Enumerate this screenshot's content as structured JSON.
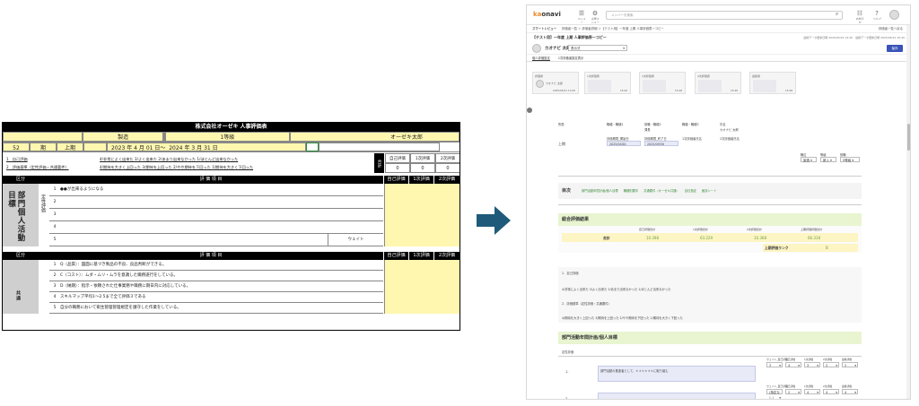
{
  "sheet": {
    "title": "株式会社オーゼキ 人事評価表",
    "row1": {
      "dept": "製造",
      "grade": "1等級",
      "name": "オーゼキ太郎"
    },
    "row2": {
      "period_no": "52",
      "period_unit": "期",
      "half": "上期",
      "from_year": "2023",
      "y1": "年",
      "from_month": "4",
      "m1": "月",
      "from_day": "01",
      "d1": "日～",
      "to_year": "2024",
      "y2": "年",
      "to_month": "3",
      "m2": "月",
      "to_day": "31",
      "d2": "日"
    },
    "legend": {
      "item1": "1　自己評価",
      "scale1": "4/非常によく出来た 3/よく出来た 2/あまり出来なかった 1/ほとんど出来なかった",
      "item2": "2　評価基準（定性評価・共通要件）",
      "scale2": "4/期待を大きく上回った 3/期待を上回った 2/やや期待を下回った 1/期待を大きく下回った",
      "total_label": "合計"
    },
    "score_headers": [
      "自己評価",
      "1次評価",
      "2次評価"
    ],
    "totals": [
      "0",
      "0",
      "0"
    ],
    "section1": {
      "col_kubun": "区分",
      "col_items": "評 価 項 目",
      "side_label": "部門個人活動目標",
      "sub_label": "定性評価",
      "items": [
        {
          "no": "1",
          "text": "●●が出来るようになる"
        },
        {
          "no": "2",
          "text": ""
        },
        {
          "no": "3",
          "text": ""
        },
        {
          "no": "4",
          "text": ""
        },
        {
          "no": "5",
          "text": ""
        }
      ],
      "weight_label": "ウェイト"
    },
    "section2": {
      "col_kubun": "区分",
      "col_items": "評 価 項 目",
      "side_label": "共通",
      "items": [
        {
          "no": "1",
          "text": "Q（品質）：図面に基づき製品の不良、良品判断ができる。"
        },
        {
          "no": "2",
          "text": "C（コスト）：ムダ・ムリ・ムラを意識した職務遂行をしている。"
        },
        {
          "no": "3",
          "text": "D（納期）：指示・依頼された仕事業務や職務に期日内に対応している。"
        },
        {
          "no": "4",
          "text": "スキルマップ平均1～2.5まで全て評価３である"
        },
        {
          "no": "5",
          "text": "自分の職務において衛生管理管理規定を遵守した作業をしている。"
        }
      ]
    }
  },
  "app": {
    "logo_prefix": "ka",
    "logo_suffix": "onavi",
    "top_icons": [
      {
        "label": "メニュー",
        "glyph": "☰"
      },
      {
        "label": "全般メニュー",
        "glyph": "⚙"
      }
    ],
    "search_placeholder": "メンバーを検索",
    "right_icons": [
      {
        "label": "お知らせ",
        "glyph": "☷"
      },
      {
        "label": "ヘルプ",
        "glyph": "?"
      }
    ],
    "crumb_left": "スマートレビュー",
    "crumb_path": "評価者一覧 ＞ 評価者詳細 ＞【テスト用】一年度 上期 人事評価表一コピー",
    "crumb_right": "評価者一覧へ戻る",
    "sheet_title": "【テスト用】一年度 上期 人事評価表一コピー",
    "sheet_meta": "最終データ更新日時 2025/05/21 13:20　最終データ更新日時 2025/05/21 15:45",
    "user_name": "カオナビ 太郎",
    "user_status": "表示式",
    "save_label": "保存",
    "tabs": [
      "個人評価設定",
      "1次評価者設定表示"
    ],
    "flow": [
      {
        "label": "評価者",
        "name": "カオナビ 太郎",
        "date": "2025/05/21 13:20"
      },
      {
        "label": "1次評価者",
        "date": "15:00"
      },
      {
        "label": "1次評価者",
        "date": "15:48"
      },
      {
        "label": "2次評価者",
        "date": "15:48"
      },
      {
        "label": "最終者",
        "date": "15:48"
      }
    ],
    "info": {
      "col1": "所属",
      "val1": "上期",
      "col2": "職種・職種1",
      "col3": "役職・職種2",
      "val3": "課長",
      "col4": "職種・職種3",
      "col5": "氏名",
      "val5": "カオナビ 太郎",
      "period_from_label": "評価期間_開始日",
      "period_from": "2025/04/01",
      "period_to_label": "評価期間_終了日",
      "period_to": "2025/09/30",
      "first_eval_label": "1次評価者氏名",
      "second_eval_label": "2次評価者氏名",
      "sel1_label": "職位",
      "sel1": "製造",
      "sel2_label": "等級",
      "sel2": "新入",
      "sel3_label": "役職",
      "sel3": "9等級"
    },
    "toc": {
      "title": "目次",
      "links": [
        "部門活動年間計画/個人目標",
        "職種別要件",
        "共通要件（オーゼキ共通）",
        "自社指定",
        "面談シート"
      ]
    },
    "summary": {
      "title": "総合評価結果",
      "headers": [
        "自己評価合計",
        "1次評価合計",
        "2次評価合計",
        "上期評価評価合計"
      ],
      "row_label": "合計",
      "values": [
        "10.398",
        "63.229",
        "10.368",
        "66.318"
      ],
      "rank_label": "上期評価ランク",
      "rank_value": "B"
    },
    "criteria": {
      "item1": "1．自己評価",
      "scale1": "4/非常によく出来た 3/よく出来た 2/あまり出来なかった 1/ほとんど出来なかった",
      "item2": "2．評価基準（定性評価・共通要件）",
      "scale2": "4/期待を大きく上回った 3/期待を上回った 2/やや期待を下回った 1/期待を大きく下回った"
    },
    "goals": {
      "title": "部門活動年間計画/個人目標",
      "sub": "定性評価",
      "col_headers": [
        "ウェイト_自己評価",
        "自己評価",
        "1次評価",
        "2次評価",
        "最終評価"
      ],
      "rows": [
        {
          "no": "1.",
          "text": "部門活動の推進者として、＊＊＊＊＊＊に取り組む",
          "weight": "3",
          "self": "4",
          "first": "3",
          "second": "2",
          "final": "2"
        },
        {
          "no": "2.",
          "text": "",
          "weight": "(指定なし)",
          "self": "2",
          "first": "4",
          "second": "4",
          "final": "4"
        }
      ]
    }
  }
}
